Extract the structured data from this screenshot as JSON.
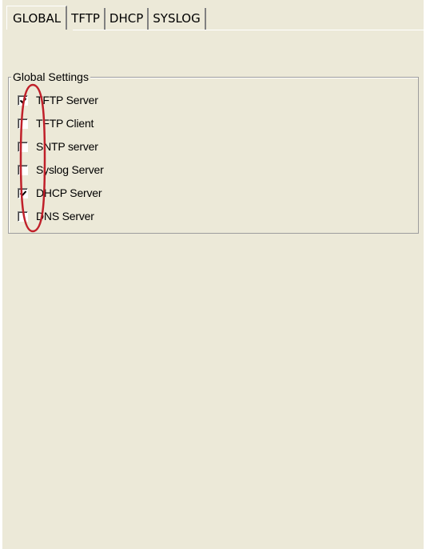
{
  "tabs": [
    {
      "label": "GLOBAL",
      "active": true
    },
    {
      "label": "TFTP",
      "active": false
    },
    {
      "label": "DHCP",
      "active": false
    },
    {
      "label": "SYSLOG",
      "active": false
    }
  ],
  "group": {
    "legend": "Global Settings",
    "checkboxes": [
      {
        "label": "TFTP Server",
        "checked": true
      },
      {
        "label": "TFTP Client",
        "checked": false
      },
      {
        "label": "SNTP server",
        "checked": false
      },
      {
        "label": "Syslog Server",
        "checked": false
      },
      {
        "label": "DHCP Server",
        "checked": true
      },
      {
        "label": "DNS Server",
        "checked": false
      }
    ]
  },
  "colors": {
    "panel_background": "#ece9d8",
    "annotation_ellipse": "#c0202a"
  }
}
